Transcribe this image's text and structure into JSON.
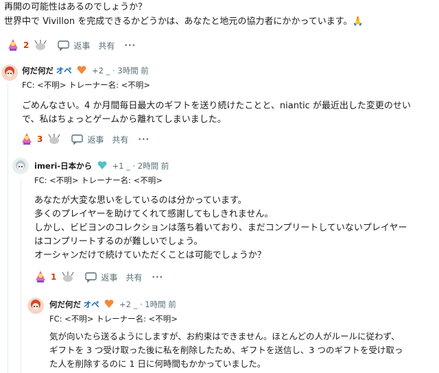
{
  "post": {
    "lines": [
      "再開の可能性はあるのでしょうか？",
      "世界中で Vivillon を完成できるかどうかは、あなたと地元の協力者にかかっています。🙏"
    ],
    "votes": "2",
    "reply_label": "返事",
    "share_label": "共有",
    "more": "···"
  },
  "comment1": {
    "user": "何だ何だ",
    "op_badge": "オペ",
    "karma": "+2 _",
    "time": "· 3時間 前",
    "fc": "FC: <不明> トレーナー名: <不明>",
    "lines": [
      "ごめんなさい。4 か月間毎日最大のギフトを送り続けたことと、niantic が最近出した変更のせい",
      "で、私はちょっとゲームから離れてしまいました。"
    ],
    "votes": "3",
    "reply_label": "返事",
    "share_label": "共有",
    "more": "···"
  },
  "comment2": {
    "user": "imeri-日本から",
    "karma": "+1 _",
    "time": "· 2時間 前",
    "fc": "FC: <不明> トレーナー名: <不明>",
    "lines": [
      "あなたが大変な思いをしているのは分かっています。",
      "多くのプレイヤーを助けてくれて感謝してもしきれません。",
      "しかし、ビビヨンのコレクションは落ち着いており、まだコンプリートしていないプレイヤー",
      "はコンプリートするのが難しいでしょう。",
      "オーシャンだけで続けていただくことは可能でしょうか？"
    ],
    "votes": "1",
    "reply_label": "返事",
    "share_label": "共有",
    "more": "···"
  },
  "comment3": {
    "user": "何だ何だ",
    "op_badge": "オペ",
    "karma": "+2 _",
    "time": "· 1時間 前",
    "fc": "FC: <不明> トレーナー名: <不明>",
    "lines": [
      "気が向いたら送るようにしますが、お約束はできません。ほとんどの人がルールに従わず、",
      "ギフトを 3 つ受け取った後に私を削除したため、ギフトを送信し、3 つのギフトを受け取っ",
      "た人を削除するのに 1 日に何時間もかかっていました。"
    ]
  },
  "icons": {
    "upvote": "upvote-flair-icon",
    "downvote": "downvote-flair-icon",
    "reply": "speech-bubble-icon",
    "karma_flair": "heart-flair-icon"
  },
  "colors": {
    "accent_vote": "#d93a00",
    "op_blue": "#0a66c2",
    "meta_gray": "#576f76",
    "thread_line": "#e5ebee"
  }
}
